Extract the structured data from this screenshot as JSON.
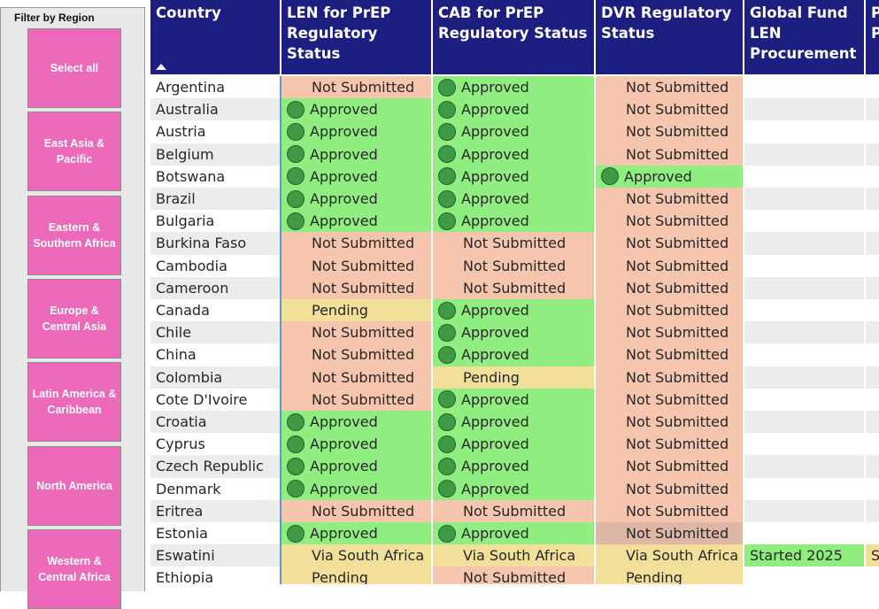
{
  "filter": {
    "title": "Filter by Region",
    "buttons": [
      {
        "label": "Select all"
      },
      {
        "label": "East Asia & Pacific"
      },
      {
        "label": "Eastern & Southern Africa"
      },
      {
        "label": "Europe & Central Asia"
      },
      {
        "label": "Latin America & Caribbean"
      },
      {
        "label": "North America"
      },
      {
        "label": "Western & Central Africa"
      }
    ],
    "button_color": "#ec6ab9"
  },
  "table": {
    "header_color": "#1c1e80",
    "columns": [
      {
        "label": "Country"
      },
      {
        "label": "LEN for PrEP Regulatory Status"
      },
      {
        "label": "CAB for PrEP Regulatory Status"
      },
      {
        "label": "DVR Regulatory Status"
      },
      {
        "label": "Global Fund LEN Procurement"
      },
      {
        "label": "P P"
      }
    ],
    "sort_indicator": "sort-ascending-icon",
    "status_colors": {
      "Approved": "#90ee80",
      "Not Submitted": "#f6c5ae",
      "Pending": "#f2e09a",
      "Via South Africa": "#f2e09a"
    },
    "rows": [
      {
        "country": "Argentina",
        "len": "Not Submitted",
        "cab": "Approved",
        "dvr": "Not Submitted",
        "gf": "",
        "extra": ""
      },
      {
        "country": "Australia",
        "len": "Approved",
        "cab": "Approved",
        "dvr": "Not Submitted",
        "gf": "",
        "extra": ""
      },
      {
        "country": "Austria",
        "len": "Approved",
        "cab": "Approved",
        "dvr": "Not Submitted",
        "gf": "",
        "extra": ""
      },
      {
        "country": "Belgium",
        "len": "Approved",
        "cab": "Approved",
        "dvr": "Not Submitted",
        "gf": "",
        "extra": ""
      },
      {
        "country": "Botswana",
        "len": "Approved",
        "cab": "Approved",
        "dvr": "Approved",
        "gf": "",
        "extra": ""
      },
      {
        "country": "Brazil",
        "len": "Approved",
        "cab": "Approved",
        "dvr": "Not Submitted",
        "gf": "",
        "extra": ""
      },
      {
        "country": "Bulgaria",
        "len": "Approved",
        "cab": "Approved",
        "dvr": "Not Submitted",
        "gf": "",
        "extra": ""
      },
      {
        "country": "Burkina Faso",
        "len": "Not Submitted",
        "cab": "Not Submitted",
        "dvr": "Not Submitted",
        "gf": "",
        "extra": ""
      },
      {
        "country": "Cambodia",
        "len": "Not Submitted",
        "cab": "Not Submitted",
        "dvr": "Not Submitted",
        "gf": "",
        "extra": ""
      },
      {
        "country": "Cameroon",
        "len": "Not Submitted",
        "cab": "Not Submitted",
        "dvr": "Not Submitted",
        "gf": "",
        "extra": ""
      },
      {
        "country": "Canada",
        "len": "Pending",
        "cab": "Approved",
        "dvr": "Not Submitted",
        "gf": "",
        "extra": ""
      },
      {
        "country": "Chile",
        "len": "Not Submitted",
        "cab": "Approved",
        "dvr": "Not Submitted",
        "gf": "",
        "extra": ""
      },
      {
        "country": "China",
        "len": "Not Submitted",
        "cab": "Approved",
        "dvr": "Not Submitted",
        "gf": "",
        "extra": ""
      },
      {
        "country": "Colombia",
        "len": "Not Submitted",
        "cab": "Pending",
        "dvr": "Not Submitted",
        "gf": "",
        "extra": ""
      },
      {
        "country": "Cote D'Ivoire",
        "len": "Not Submitted",
        "cab": "Approved",
        "dvr": "Not Submitted",
        "gf": "",
        "extra": ""
      },
      {
        "country": "Croatia",
        "len": "Approved",
        "cab": "Approved",
        "dvr": "Not Submitted",
        "gf": "",
        "extra": ""
      },
      {
        "country": "Cyprus",
        "len": "Approved",
        "cab": "Approved",
        "dvr": "Not Submitted",
        "gf": "",
        "extra": ""
      },
      {
        "country": "Czech Republic",
        "len": "Approved",
        "cab": "Approved",
        "dvr": "Not Submitted",
        "gf": "",
        "extra": ""
      },
      {
        "country": "Denmark",
        "len": "Approved",
        "cab": "Approved",
        "dvr": "Not Submitted",
        "gf": "",
        "extra": ""
      },
      {
        "country": "Eritrea",
        "len": "Not Submitted",
        "cab": "Not Submitted",
        "dvr": "Not Submitted",
        "gf": "",
        "extra": ""
      },
      {
        "country": "Estonia",
        "len": "Approved",
        "cab": "Approved",
        "dvr": "Not Submitted",
        "dvr_highlight": true,
        "gf": "",
        "extra": ""
      },
      {
        "country": "Eswatini",
        "len": "Via South Africa",
        "cab": "Via South Africa",
        "dvr": "Via South Africa",
        "gf": "Started 2025",
        "extra": "S"
      },
      {
        "country": "Ethiopia",
        "len": "Pending",
        "cab": "Not Submitted",
        "dvr": "Pending",
        "gf": "",
        "extra": ""
      }
    ]
  }
}
